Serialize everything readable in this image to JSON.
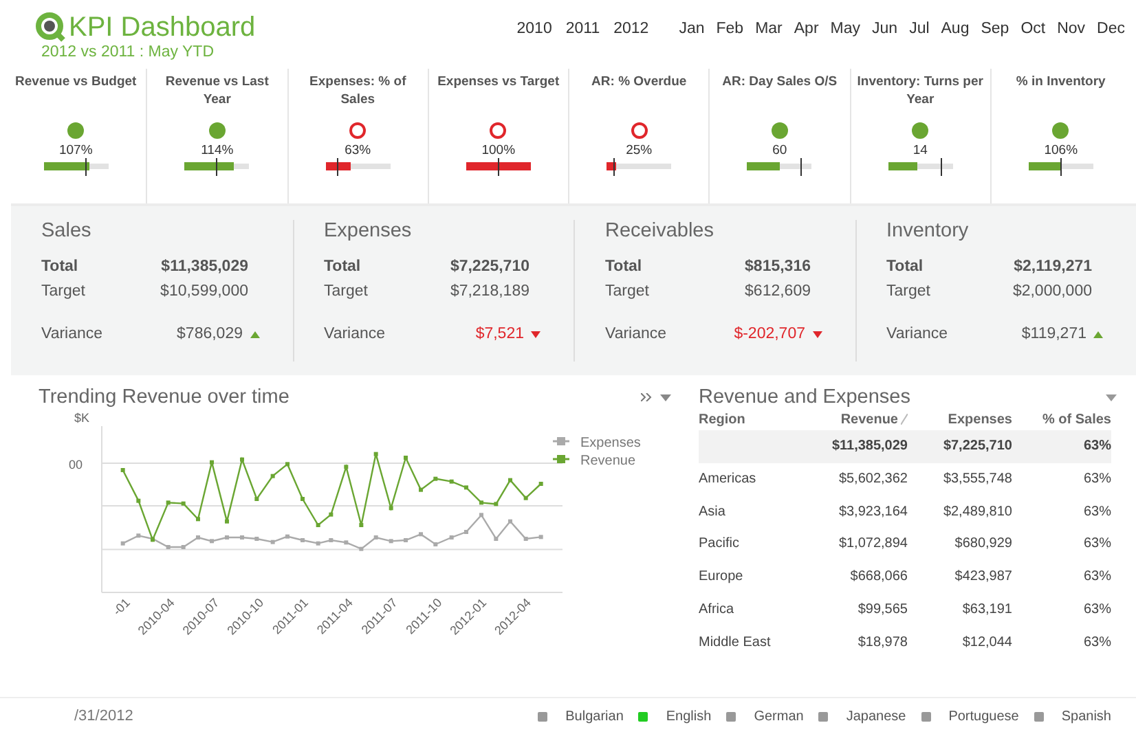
{
  "header": {
    "title": "KPI Dashboard",
    "subtitle": "2012 vs 2011 : May YTD",
    "years": [
      "2010",
      "2011",
      "2012"
    ],
    "months": [
      "Jan",
      "Feb",
      "Mar",
      "Apr",
      "May",
      "Jun",
      "Jul",
      "Aug",
      "Sep",
      "Oct",
      "Nov",
      "Dec"
    ]
  },
  "kpis": [
    {
      "title": "Revenue vs Budget",
      "ok": true,
      "value": "107%",
      "level": 0.7,
      "target": {
        "level": 0.65
      }
    },
    {
      "title": "Revenue vs Last Year",
      "ok": true,
      "value": "114%",
      "level": 0.76,
      "target": {
        "level": 0.48
      }
    },
    {
      "title": "Expenses: % of Sales",
      "ok": false,
      "value": "63%",
      "level": 0.4,
      "target": {
        "level": 0.17
      }
    },
    {
      "title": "Expenses vs Target",
      "ok": false,
      "value": "100%",
      "level": 1,
      "target": {
        "level": 0.5
      }
    },
    {
      "title": "AR: % Overdue",
      "ok": false,
      "value": "25%",
      "level": 0.15,
      "target": {
        "level": 0.1
      }
    },
    {
      "title": "AR: Day Sales O/S",
      "ok": true,
      "value": "60",
      "level": 0.5,
      "target": {
        "level": 0.82
      }
    },
    {
      "title": "Inventory: Turns per Year",
      "ok": true,
      "value": "14",
      "level": 0.45,
      "target": {
        "level": 0.82
      }
    },
    {
      "title": "% in Inventory",
      "ok": true,
      "value": "106%",
      "level": 0.5,
      "target": {
        "level": 0.5
      }
    }
  ],
  "summary": [
    {
      "title": "Sales",
      "total_label": "Total",
      "total": "$11,385,029",
      "target_label": "Target",
      "target": "$10,599,000",
      "variance_label": "Variance",
      "variance": "$786,029",
      "rising": true
    },
    {
      "title": "Expenses",
      "total_label": "Total",
      "total": "$7,225,710",
      "target_label": "Target",
      "target": "$7,218,189",
      "variance_label": "Variance",
      "variance": "$7,521",
      "rising": false
    },
    {
      "title": "Receivables",
      "total_label": "Total",
      "total": "$815,316",
      "target_label": "Target",
      "target": "$612,609",
      "variance_label": "Variance",
      "variance": "$-202,707",
      "rising": false
    },
    {
      "title": "Inventory",
      "total_label": "Total",
      "total": "$2,119,271",
      "target_label": "Target",
      "target": "$2,000,000",
      "variance_label": "Variance",
      "variance": "$119,271",
      "rising": true
    }
  ],
  "trend_chart": {
    "title": "Trending Revenue over time",
    "y_unit": "$K",
    "y_tick": "00",
    "x_labels": [
      "-01",
      "2010-04",
      "2010-07",
      "2010-10",
      "2011-01",
      "2011-04",
      "2011-07",
      "2011-10",
      "2012-01",
      "2012-04"
    ],
    "legend": [
      {
        "name": "Expenses",
        "color": "#aaaaaa"
      },
      {
        "name": "Revenue",
        "color": "#6aa632"
      }
    ]
  },
  "table": {
    "title": "Revenue and Expenses",
    "columns": [
      "Region",
      "Revenue",
      "Expenses",
      "% of Sales"
    ],
    "totals": [
      "$11,385,029",
      "$7,225,710",
      "63%"
    ],
    "rows": [
      [
        "Americas",
        "$5,602,362",
        "$3,555,748",
        "63%"
      ],
      [
        "Asia",
        "$3,923,164",
        "$2,489,810",
        "63%"
      ],
      [
        "Pacific",
        "$1,072,894",
        "$680,929",
        "63%"
      ],
      [
        "Europe",
        "$668,066",
        "$423,987",
        "63%"
      ],
      [
        "Africa",
        "$99,565",
        "$63,191",
        "63%"
      ],
      [
        "Middle East",
        "$18,978",
        "$12,044",
        "63%"
      ]
    ]
  },
  "footer": {
    "date": "/31/2012",
    "languages": [
      {
        "name": "Bulgarian",
        "selected": false
      },
      {
        "name": "English",
        "selected": true
      },
      {
        "name": "German",
        "selected": false
      },
      {
        "name": "Japanese",
        "selected": false
      },
      {
        "name": "Portuguese",
        "selected": false
      },
      {
        "name": "Spanish",
        "selected": false
      }
    ]
  }
}
